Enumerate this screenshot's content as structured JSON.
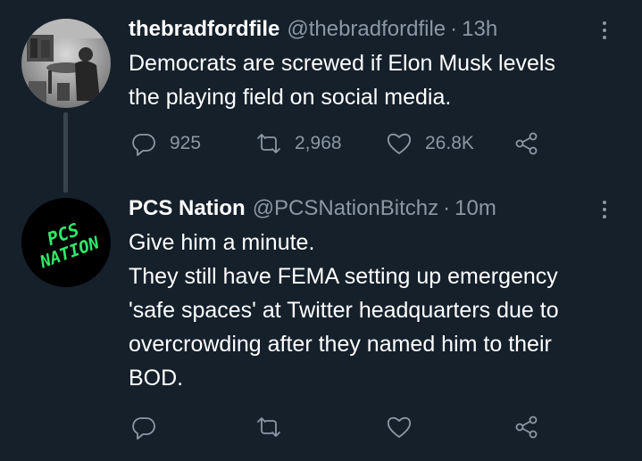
{
  "tweets": [
    {
      "author_name": "thebradfordfile",
      "author_handle": "@thebradfordfile",
      "separator": "·",
      "time": "13h",
      "text": "Democrats are screwed if Elon Musk levels\nthe playing field on social media.",
      "replies": "925",
      "retweets": "2,968",
      "likes": "26.8K"
    },
    {
      "author_name": "PCS Nation",
      "author_handle": "@PCSNationBitchz",
      "separator": "·",
      "time": "10m",
      "text": "Give him a minute.\nThey still have FEMA setting up emergency\n'safe spaces' at Twitter headquarters due to\novercrowding after they named him to their\nBOD.",
      "replies": "",
      "retweets": "",
      "likes": "",
      "avatar_text_line1": "PCS",
      "avatar_text_line2": "NATION"
    }
  ],
  "colors": {
    "background": "#15202b",
    "secondary_text": "#8b98a5",
    "thread_line": "#38444d",
    "pcs_logo_green": "#2ee86b"
  },
  "icons": [
    "reply-icon",
    "retweet-icon",
    "like-icon",
    "share-icon",
    "more-icon"
  ]
}
